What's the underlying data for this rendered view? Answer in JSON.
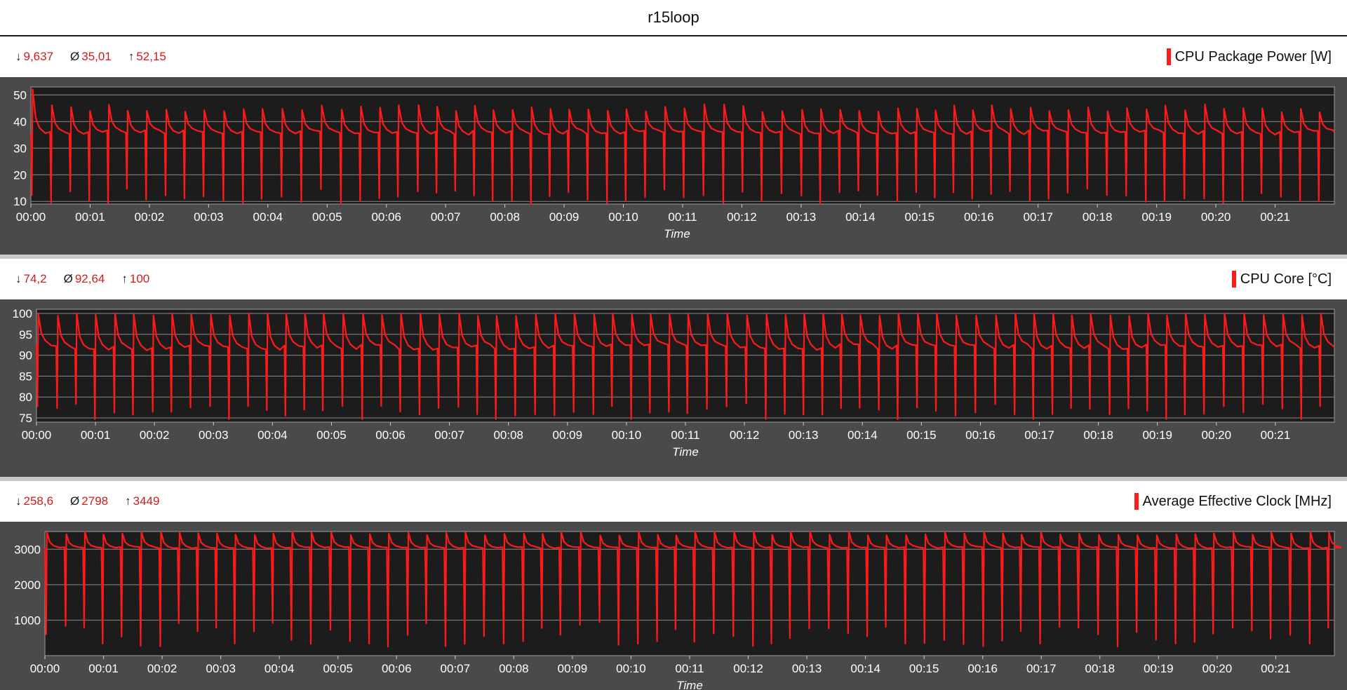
{
  "page_title": "r15loop",
  "time_axis_title": "Time",
  "x_ticks": [
    "00:00",
    "00:01",
    "00:02",
    "00:03",
    "00:04",
    "00:05",
    "00:06",
    "00:07",
    "00:08",
    "00:09",
    "00:10",
    "00:11",
    "00:12",
    "00:13",
    "00:14",
    "00:15",
    "00:16",
    "00:17",
    "00:18",
    "00:19",
    "00:20",
    "00:21"
  ],
  "colors": {
    "series": "#ff1a1a",
    "stat_value": "#d01c1c",
    "plot_bg": "#1c1c1c",
    "frame_bg": "#4a4a4a",
    "grid": "#8a8a8a"
  },
  "panels": [
    {
      "legend": "CPU Package Power [W]",
      "stats": {
        "min_symbol": "↓",
        "min": "9,637",
        "avg_symbol": "Ø",
        "avg": "35,01",
        "max_symbol": "↑",
        "max": "52,15"
      }
    },
    {
      "legend": "CPU Core [°C]",
      "stats": {
        "min_symbol": "↓",
        "min": "74,2",
        "avg_symbol": "Ø",
        "avg": "92,64",
        "max_symbol": "↑",
        "max": "100"
      }
    },
    {
      "legend": "Average Effective Clock [MHz]",
      "stats": {
        "min_symbol": "↓",
        "min": "258,6",
        "avg_symbol": "Ø",
        "avg": "2798",
        "max_symbol": "↑",
        "max": "3449"
      }
    }
  ],
  "chart_data": [
    {
      "type": "line",
      "title": "",
      "xlabel": "Time",
      "ylabel": "",
      "series": [
        {
          "name": "CPU Package Power [W]",
          "pattern": "periodic load cycles",
          "cycle_seconds": 19.5,
          "first_peak": 52.15,
          "peak": 45,
          "plateau": 36,
          "dip": 12,
          "min": 9.637,
          "avg": 35.01
        }
      ],
      "yticks": [
        10,
        20,
        30,
        40,
        50
      ],
      "ylim": [
        9,
        53
      ],
      "xlim_seconds": [
        0,
        1320
      ],
      "grid": true
    },
    {
      "type": "line",
      "title": "",
      "xlabel": "Time",
      "ylabel": "",
      "series": [
        {
          "name": "CPU Core [°C]",
          "pattern": "periodic load cycles",
          "cycle_seconds": 19.5,
          "peak": 100,
          "plateau": 92,
          "dip": 77,
          "min": 74.2,
          "avg": 92.64
        }
      ],
      "yticks": [
        75,
        80,
        85,
        90,
        95,
        100
      ],
      "ylim": [
        74,
        101
      ],
      "xlim_seconds": [
        0,
        1320
      ],
      "grid": true
    },
    {
      "type": "line",
      "title": "",
      "xlabel": "Time",
      "ylabel": "",
      "series": [
        {
          "name": "Average Effective Clock [MHz]",
          "pattern": "periodic load cycles",
          "cycle_seconds": 19.5,
          "peak": 3449,
          "plateau": 3050,
          "dip": 600,
          "min": 258.6,
          "avg": 2798
        }
      ],
      "yticks": [
        1000,
        2000,
        3000
      ],
      "ylim": [
        0,
        3500
      ],
      "xlim_seconds": [
        0,
        1320
      ],
      "grid": true
    }
  ]
}
